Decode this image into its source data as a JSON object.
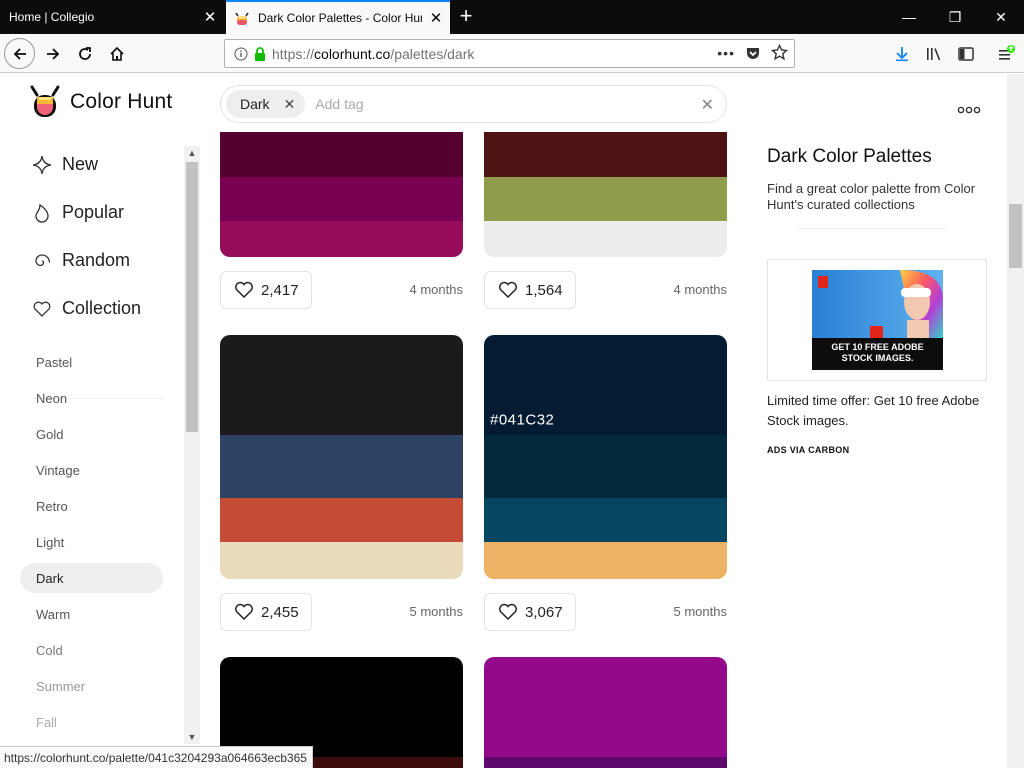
{
  "browser": {
    "tabs": [
      {
        "title": "Home | Collegio",
        "active": false
      },
      {
        "title": "Dark Color Palettes - Color Hunt",
        "active": true
      }
    ],
    "url_prefix": "https://",
    "url_domain": "colorhunt.co",
    "url_path": "/palettes/dark",
    "status_url": "https://colorhunt.co/palette/041c3204293a064663ecb365",
    "accent_color": "#0a84ff"
  },
  "header": {
    "logo_text": "Color Hunt",
    "search_chip": "Dark",
    "search_placeholder": "Add tag",
    "more_icon": "more-dots-icon"
  },
  "sidebar": {
    "main_nav": [
      {
        "label": "New",
        "icon": "sparkle-icon"
      },
      {
        "label": "Popular",
        "icon": "flame-icon"
      },
      {
        "label": "Random",
        "icon": "spiral-icon"
      },
      {
        "label": "Collection",
        "icon": "heart-icon"
      }
    ],
    "tags": [
      "Pastel",
      "Neon",
      "Gold",
      "Vintage",
      "Retro",
      "Light",
      "Dark",
      "Warm",
      "Cold",
      "Summer",
      "Fall"
    ],
    "active_tag": "Dark"
  },
  "palettes": [
    {
      "colors": [
        "#56002f",
        "#770052",
        "#970d5b"
      ],
      "likes": "2,417",
      "age": "4 months"
    },
    {
      "colors": [
        "#4f1213",
        "#8e9c4b",
        "#ececec"
      ],
      "likes": "1,564",
      "age": "4 months"
    },
    {
      "colors": [
        "#1b1b1b",
        "#2e4264",
        "#c44b34",
        "#eadbbc"
      ],
      "likes": "2,455",
      "age": "5 months"
    },
    {
      "colors": [
        "#041c32",
        "#04293a",
        "#064663",
        "#ecb365"
      ],
      "likes": "3,067",
      "age": "5 months",
      "hover_label": "#041C32"
    },
    {
      "colors": [
        "#000000",
        "#3d0c0c"
      ],
      "likes": "",
      "age": ""
    },
    {
      "colors": [
        "#920a8a",
        "#5c0a6c"
      ],
      "likes": "",
      "age": ""
    }
  ],
  "aside": {
    "title": "Dark Color Palettes",
    "description": "Find a great color palette from Color Hunt's curated collections",
    "ad_image_text": "GET 10 FREE ADOBE STOCK IMAGES.",
    "ad_text": "Limited time offer: Get 10 free Adobe Stock images.",
    "ad_via": "ADS VIA CARBON"
  }
}
